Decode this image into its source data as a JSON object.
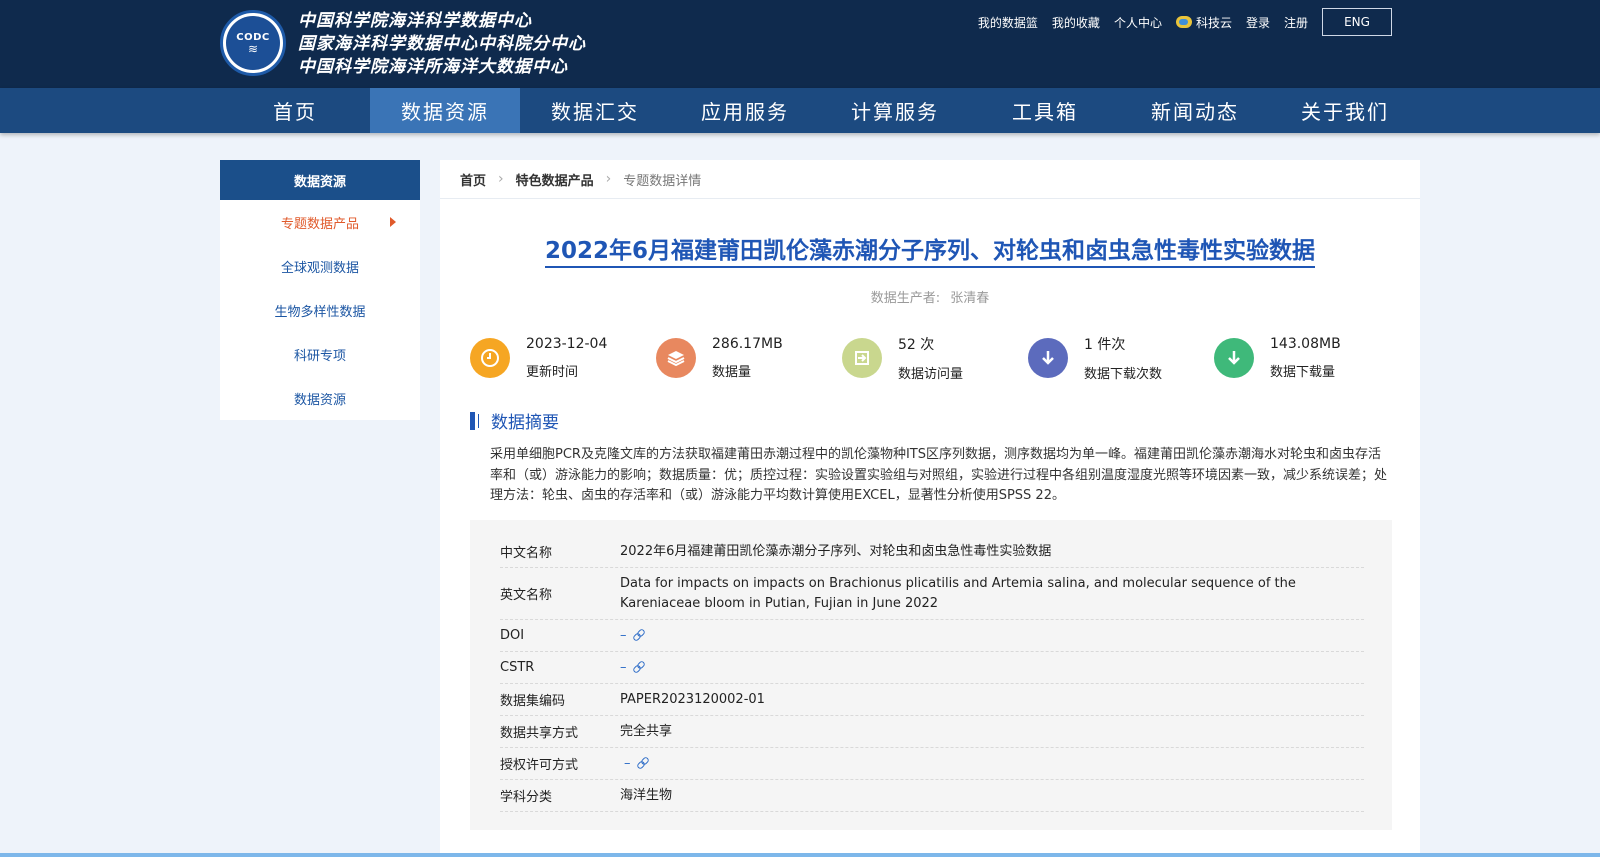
{
  "header": {
    "logo_text": "CODC",
    "org_names": [
      "中国科学院海洋科学数据中心",
      "国家海洋科学数据中心中科院分中心",
      "中国科学院海洋所海洋大数据中心"
    ],
    "links": [
      "我的数据篮",
      "我的收藏",
      "个人中心",
      "科技云",
      "登录",
      "注册"
    ],
    "lang_button": "ENG"
  },
  "nav": {
    "items": [
      "首页",
      "数据资源",
      "数据汇交",
      "应用服务",
      "计算服务",
      "工具箱",
      "新闻动态",
      "关于我们"
    ],
    "active_index": 1
  },
  "sidebar": {
    "title": "数据资源",
    "items": [
      "专题数据产品",
      "全球观测数据",
      "生物多样性数据",
      "科研专项",
      "数据资源"
    ],
    "active_index": 0
  },
  "breadcrumb": [
    "首页",
    "特色数据产品",
    "专题数据详情"
  ],
  "dataset": {
    "title": "2022年6月福建莆田凯伦藻赤潮分子序列、对轮虫和卤虫急性毒性实验数据",
    "producer_label": "数据生产者:",
    "producer_name": "张清春",
    "stats": [
      {
        "value": "2023-12-04",
        "label": "更新时间",
        "icon": "clock-icon",
        "color": "#f6a623"
      },
      {
        "value": "286.17MB",
        "label": "数据量",
        "icon": "layers-icon",
        "color": "#e8885f"
      },
      {
        "value": "52 次",
        "label": "数据访问量",
        "icon": "login-icon",
        "color": "#c9d78e"
      },
      {
        "value": "1 件次",
        "label": "数据下载次数",
        "icon": "download-icon",
        "color": "#5c6bbd"
      },
      {
        "value": "143.08MB",
        "label": "数据下载量",
        "icon": "download-icon",
        "color": "#3fb97a"
      }
    ],
    "abstract_title": "数据摘要",
    "abstract": "采用单细胞PCR及克隆文库的方法获取福建莆田赤潮过程中的凯伦藻物种ITS区序列数据，测序数据均为单一峰。福建莆田凯伦藻赤潮海水对轮虫和卤虫存活率和（或）游泳能力的影响；数据质量：优；质控过程：实验设置实验组与对照组，实验进行过程中各组别温度湿度光照等环境因素一致，减少系统误差；处理方法：轮虫、卤虫的存活率和（或）游泳能力平均数计算使用EXCEL，显著性分析使用SPSS 22。",
    "info": [
      {
        "label": "中文名称",
        "value": "2022年6月福建莆田凯伦藻赤潮分子序列、对轮虫和卤虫急性毒性实验数据"
      },
      {
        "label": "英文名称",
        "value": "Data for impacts on impacts on Brachionus plicatilis and Artemia salina, and molecular sequence of the Kareniaceae bloom in Putian, Fujian in June 2022"
      },
      {
        "label": "DOI",
        "value": "–"
      },
      {
        "label": "CSTR",
        "value": "–"
      },
      {
        "label": "数据集编码",
        "value": "PAPER2023120002-01"
      },
      {
        "label": "数据共享方式",
        "value": "完全共享"
      },
      {
        "label": "授权许可方式",
        "value": "–"
      },
      {
        "label": "学科分类",
        "value": "海洋生物"
      }
    ]
  }
}
